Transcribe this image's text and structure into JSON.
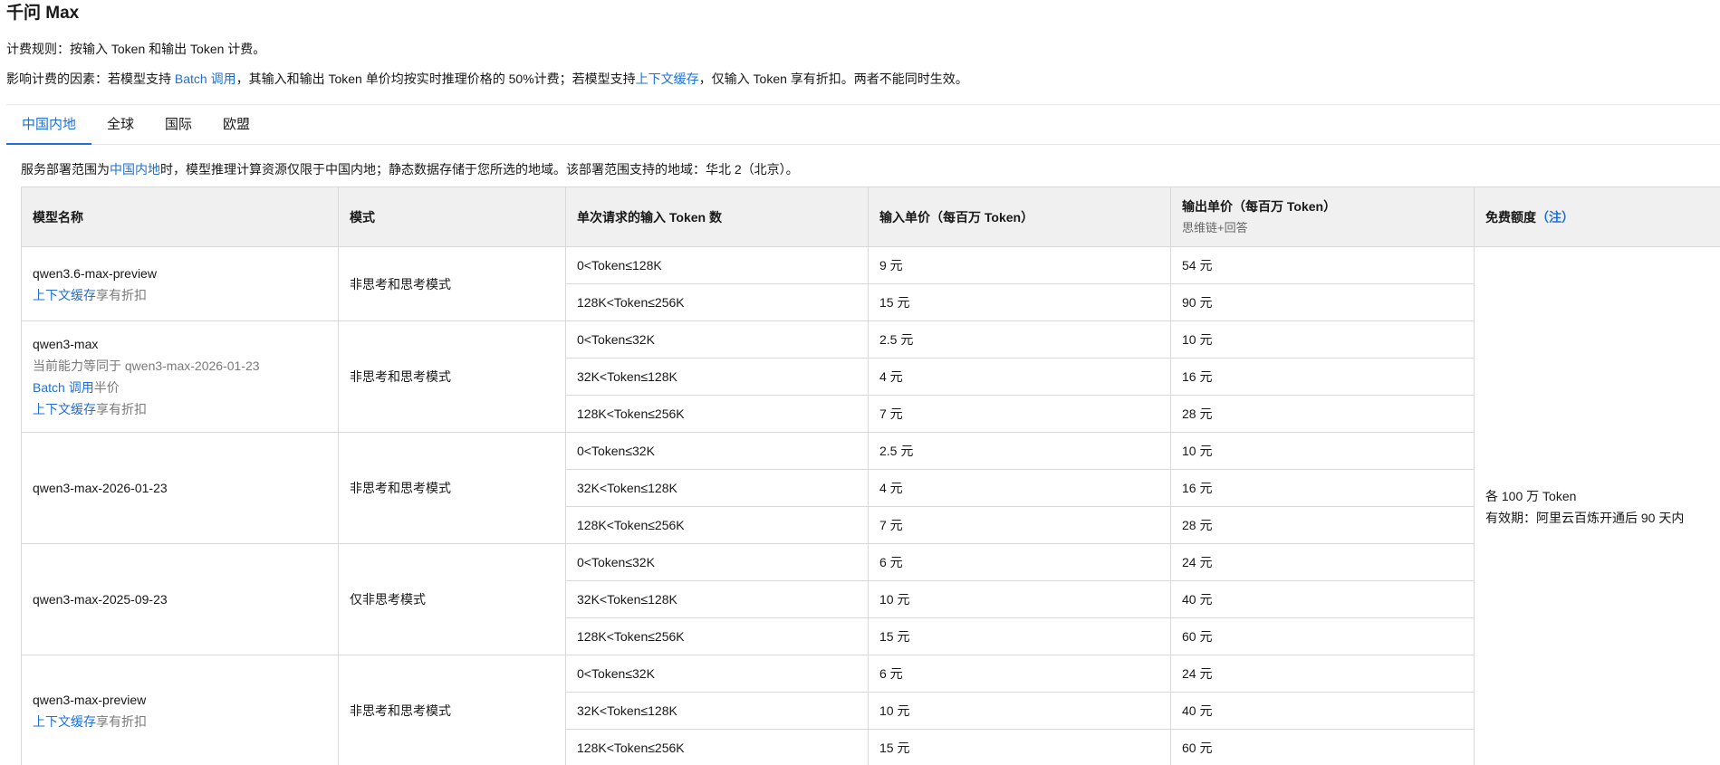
{
  "page": {
    "title": "千问 Max",
    "billing_rule": "计费规则：按输入 Token 和输出 Token 计费。",
    "factors": {
      "prefix": "影响计费的因素：若模型支持 ",
      "batch_link": "Batch 调用",
      "middle": "，其输入和输出 Token 单价均按实时推理价格的 50%计费；若模型支持",
      "cache_link": "上下文缓存",
      "suffix": "，仅输入 Token 享有折扣。两者不能同时生效。"
    }
  },
  "tabs": [
    {
      "label": "中国内地",
      "active": true
    },
    {
      "label": "全球",
      "active": false
    },
    {
      "label": "国际",
      "active": false
    },
    {
      "label": "欧盟",
      "active": false
    }
  ],
  "scope": {
    "prefix": "服务部署范围为",
    "link": "中国内地",
    "suffix": "时，模型推理计算资源仅限于中国内地；静态数据存储于您所选的地域。该部署范围支持的地域：华北 2（北京）。"
  },
  "table": {
    "headers": {
      "model": "模型名称",
      "mode": "模式",
      "tokens": "单次请求的输入 Token 数",
      "input_price": "输入单价（每百万 Token）",
      "output_price": "输出单价（每百万 Token）",
      "output_sub": "思维链+回答",
      "free": "免费额度",
      "free_note": "（注）"
    },
    "free_quota": {
      "line1": "各 100 万 Token",
      "line2": "有效期：阿里云百炼开通后 90 天内"
    },
    "notes": {
      "cache_link": "上下文缓存",
      "cache_suffix": "享有折扣",
      "batch_link": "Batch 调用",
      "batch_suffix": "半价"
    },
    "groups": [
      {
        "model": "qwen3.6-max-preview",
        "mode": "非思考和思考模式",
        "rows": [
          {
            "tokens": "0<Token≤128K",
            "input": "9 元",
            "output": "54 元"
          },
          {
            "tokens": "128K<Token≤256K",
            "input": "15 元",
            "output": "90 元"
          }
        ]
      },
      {
        "model": "qwen3-max",
        "equivalent": "当前能力等同于 qwen3-max-2026-01-23",
        "mode": "非思考和思考模式",
        "rows": [
          {
            "tokens": "0<Token≤32K",
            "input": "2.5 元",
            "output": "10 元"
          },
          {
            "tokens": "32K<Token≤128K",
            "input": "4 元",
            "output": "16 元"
          },
          {
            "tokens": "128K<Token≤256K",
            "input": "7 元",
            "output": "28 元"
          }
        ]
      },
      {
        "model": "qwen3-max-2026-01-23",
        "mode": "非思考和思考模式",
        "rows": [
          {
            "tokens": "0<Token≤32K",
            "input": "2.5 元",
            "output": "10 元"
          },
          {
            "tokens": "32K<Token≤128K",
            "input": "4 元",
            "output": "16 元"
          },
          {
            "tokens": "128K<Token≤256K",
            "input": "7 元",
            "output": "28 元"
          }
        ]
      },
      {
        "model": "qwen3-max-2025-09-23",
        "mode": "仅非思考模式",
        "rows": [
          {
            "tokens": "0<Token≤32K",
            "input": "6 元",
            "output": "24 元"
          },
          {
            "tokens": "32K<Token≤128K",
            "input": "10 元",
            "output": "40 元"
          },
          {
            "tokens": "128K<Token≤256K",
            "input": "15 元",
            "output": "60 元"
          }
        ]
      },
      {
        "model": "qwen3-max-preview",
        "mode": "非思考和思考模式",
        "rows": [
          {
            "tokens": "0<Token≤32K",
            "input": "6 元",
            "output": "24 元"
          },
          {
            "tokens": "32K<Token≤128K",
            "input": "10 元",
            "output": "40 元"
          },
          {
            "tokens": "128K<Token≤256K",
            "input": "15 元",
            "output": "60 元"
          }
        ]
      }
    ]
  }
}
